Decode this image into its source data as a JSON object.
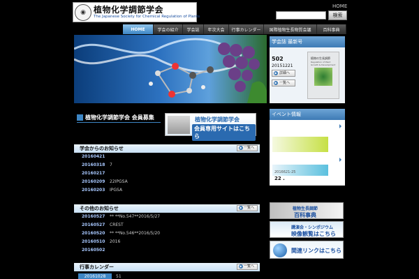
{
  "header": {
    "logo_mark": "◉",
    "logo_jp": "植物化学調節学会",
    "logo_en": "The Japanese Society for Chemical Regulation of Plants",
    "home_link": "HOME",
    "search": {
      "placeholder": "",
      "button": "検索"
    }
  },
  "nav": {
    "items": [
      {
        "label": "HOME",
        "active": true
      },
      {
        "label": "学会の紹介"
      },
      {
        "label": "学会誌"
      },
      {
        "label": "年次大会"
      },
      {
        "label": "行事カレンダー"
      },
      {
        "label": "国際植物生長物質会議"
      },
      {
        "label": "百科事典"
      }
    ]
  },
  "journal": {
    "title": "学会誌 最新号",
    "number": "502",
    "date": "20151221",
    "detail_button": "詳細へ",
    "list_button": "一覧へ",
    "cover_title": "植物の生長調節",
    "cover_subtitle": "Regulation of Plant Growth & Development"
  },
  "recruit": {
    "title": "植物化学調節学会 会員募集",
    "banner_line1": "植物化学調節学会",
    "banner_line2": "会員専用サイトはこちら"
  },
  "news_society": {
    "title": "学会からのお知らせ",
    "more": "一覧へ",
    "rows": [
      {
        "date": "20160421",
        "text": ""
      },
      {
        "date": "20160318",
        "text": "7"
      },
      {
        "date": "20160217",
        "text": ""
      },
      {
        "date": "20160209",
        "text": "22IPGSA"
      },
      {
        "date": "20160203",
        "text": "IPGSA"
      }
    ]
  },
  "news_other": {
    "title": "その他のお知らせ",
    "more": "一覧へ",
    "rows": [
      {
        "date": "20160527",
        "text": "** **No.547**2016/5/27"
      },
      {
        "date": "20160527",
        "text": "CREST"
      },
      {
        "date": "20160520",
        "text": "** **No.546**2016/5/20"
      },
      {
        "date": "20160510",
        "text": "2016"
      },
      {
        "date": "20160502",
        "text": ""
      }
    ]
  },
  "calendar": {
    "title": "行事カレンダー",
    "more": "一覧へ",
    "first_date": "20161028",
    "first_text": "51"
  },
  "events": {
    "title": "イベント情報",
    "date": "2016621-25",
    "num": "22 ."
  },
  "banners": {
    "encyclopedia_line1": "植物生長調節",
    "encyclopedia_line2": "百科事典",
    "video_line1": "講演会・シンポジウム",
    "video_line2": "映像観覧はこちら",
    "links": "関連リンクはこちら"
  }
}
